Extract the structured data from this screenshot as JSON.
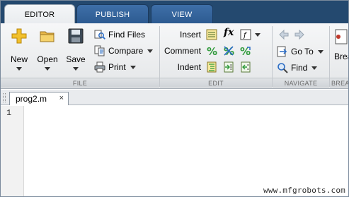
{
  "tabs": [
    {
      "label": "EDITOR",
      "active": true
    },
    {
      "label": "PUBLISH",
      "active": false
    },
    {
      "label": "VIEW",
      "active": false
    }
  ],
  "file_section": {
    "title": "FILE",
    "new_label": "New",
    "open_label": "Open",
    "save_label": "Save",
    "find_files_label": "Find Files",
    "compare_label": "Compare",
    "print_label": "Print"
  },
  "edit_section": {
    "title": "EDIT",
    "insert_label": "Insert",
    "comment_label": "Comment",
    "indent_label": "Indent",
    "fx_label": "fx"
  },
  "navigate_section": {
    "title": "NAVIGATE",
    "goto_label": "Go To",
    "find_label": "Find"
  },
  "breakpoints_section": {
    "title": "BREA",
    "button_label": "Brea"
  },
  "document": {
    "tab_label": "prog2.m",
    "close_symbol": "×",
    "line_numbers": [
      "1"
    ]
  },
  "watermark": "www.mfgrobots.com",
  "colors": {
    "tabstrip": "#24496f",
    "ribbon": "#e4e6e8",
    "accent_yellow": "#f2c12e",
    "accent_blue": "#2b6cc4",
    "accent_green": "#2f9a3a"
  }
}
